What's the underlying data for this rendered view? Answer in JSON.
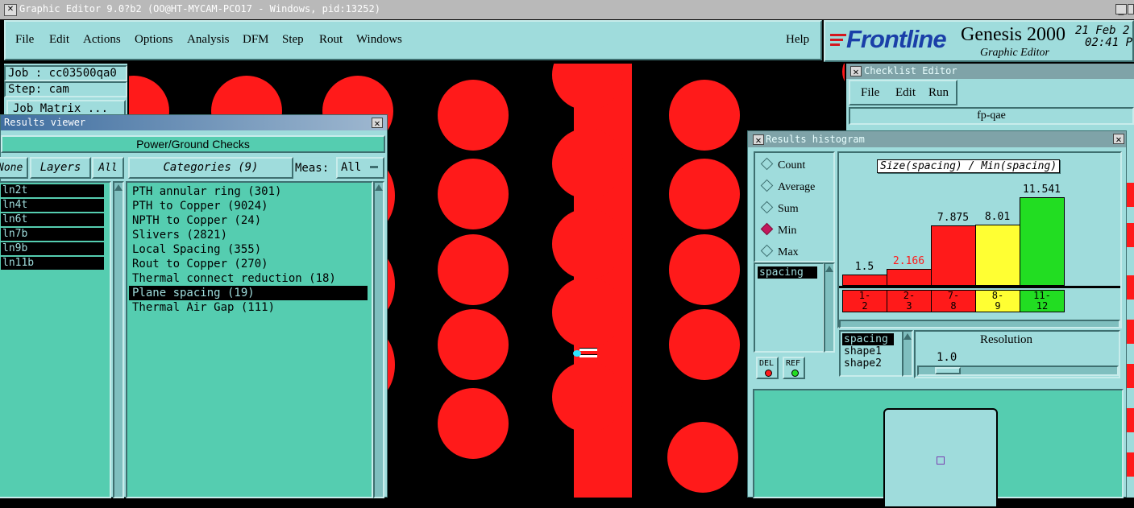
{
  "window": {
    "title": "Graphic Editor 9.0?b2 (OO@HT-MYCAM-PCO17 - Windows, pid:13252)"
  },
  "menubar": {
    "items": [
      "File",
      "Edit",
      "Actions",
      "Options",
      "Analysis",
      "DFM",
      "Step",
      "Rout",
      "Windows"
    ],
    "help": "Help"
  },
  "brand": {
    "logo": "Frontline",
    "product": "Genesis 2000",
    "subtitle": "Graphic Editor",
    "date": "21 Feb 2",
    "time": "02:41 P"
  },
  "job": {
    "job_label": "Job : cc03500qa0",
    "step_label": "Step: cam",
    "matrix_button": "Job Matrix ..."
  },
  "results_viewer": {
    "title": "Results viewer",
    "heading": "Power/Ground Checks",
    "none_button": "None",
    "layers_button": "Layers",
    "all_button": "All",
    "categories_button": "Categories (9)",
    "meas_label": "Meas:",
    "meas_value": "All",
    "layers": [
      "ln2t",
      "ln4t",
      "ln6t",
      "ln7b",
      "ln9b",
      "ln11b"
    ],
    "categories": [
      "PTH annular ring (301)",
      "PTH to Copper (9024)",
      "NPTH to Copper (24)",
      "Slivers (2821)",
      "Local Spacing (355)",
      "Rout to Copper (270)",
      "Thermal connect reduction (18)",
      "Plane spacing (19)",
      "Thermal Air Gap (111)"
    ],
    "selected_category": 7
  },
  "checklist_editor": {
    "title": "Checklist Editor",
    "menu": [
      "File",
      "Edit",
      "Run"
    ],
    "name": "fp-qae"
  },
  "results_histogram": {
    "title": "Results histogram",
    "modes": [
      "Count",
      "Average",
      "Sum",
      "Min",
      "Max"
    ],
    "selected_mode": "Min",
    "attribute": "spacing",
    "chart_title": "Size(spacing) / Min(spacing)",
    "del_label": "DEL",
    "ref_label": "REF",
    "attr_list": [
      "spacing",
      "shape1",
      "shape2"
    ],
    "resolution_label": "Resolution",
    "resolution_value": "1.0"
  },
  "chart_data": {
    "type": "bar",
    "title": "Size(spacing) / Min(spacing)",
    "categories": [
      "1-2",
      "2-3",
      "7-8",
      "8-9",
      "11-12"
    ],
    "bin_labels": [
      [
        "1-",
        "2"
      ],
      [
        "2-",
        "3"
      ],
      [
        "7-",
        "8"
      ],
      [
        "8-",
        "9"
      ],
      [
        "11-",
        "12"
      ]
    ],
    "values": [
      1.5,
      2.166,
      7.875,
      8.01,
      11.541
    ],
    "value_labels": [
      "1.5",
      "2.166",
      "7.875",
      "8.01",
      "11.541"
    ],
    "colors": [
      "#ff1a1a",
      "#ff1a1a",
      "#ff1a1a",
      "#ffff33",
      "#22dd22"
    ],
    "label_colors": [
      "#000000",
      "#ff1a1a",
      "#000000",
      "#000000",
      "#000000"
    ],
    "ylim": [
      0,
      12.6
    ]
  },
  "colors": {
    "pad": "#ff1a1a",
    "panel": "#9fdcdc",
    "list_bg": "#55cdb0",
    "selected": "#000000"
  }
}
